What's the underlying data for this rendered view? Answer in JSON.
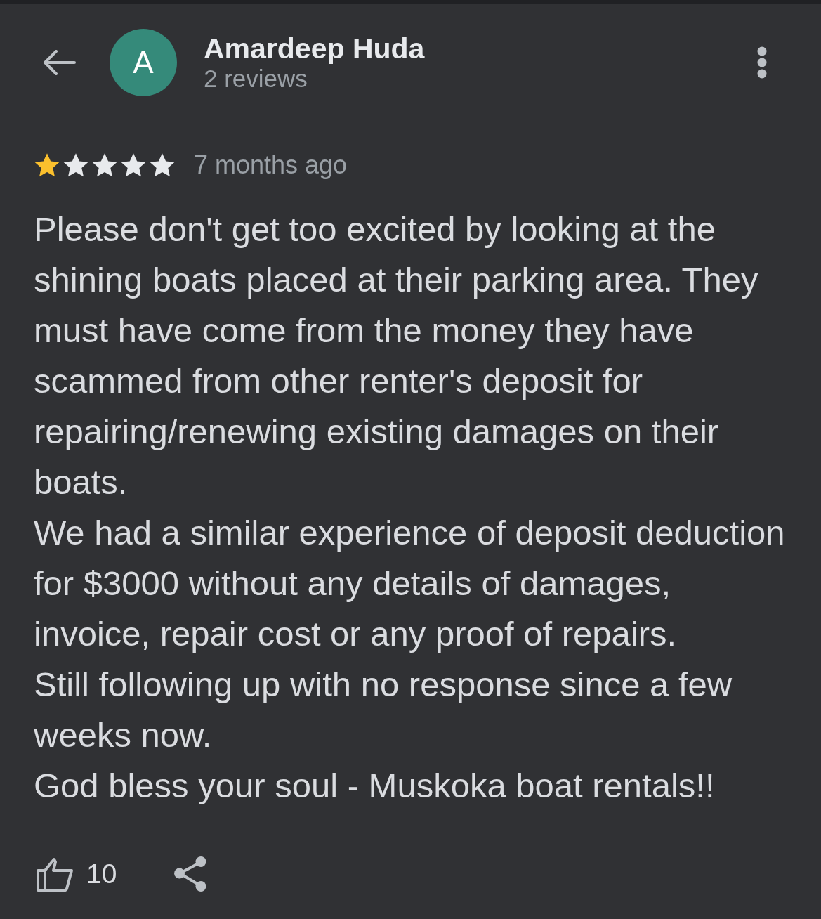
{
  "reviewer": {
    "avatar_letter": "A",
    "name": "Amardeep Huda",
    "review_count": "2 reviews"
  },
  "review": {
    "stars": 1,
    "time": "7 months ago",
    "paragraphs": [
      "Please don't get too excited by looking at the shining boats placed at their parking area. They must have come from the money they have scammed from other renter's deposit for repairing/renewing existing damages on their boats.",
      "We had a similar experience of deposit deduction for $3000 without any details of damages, invoice, repair cost or any proof of repairs.",
      "Still following up with no response since a few weeks now.",
      "God bless your soul - Muskoka boat rentals!!"
    ]
  },
  "actions": {
    "like_count": "10"
  }
}
